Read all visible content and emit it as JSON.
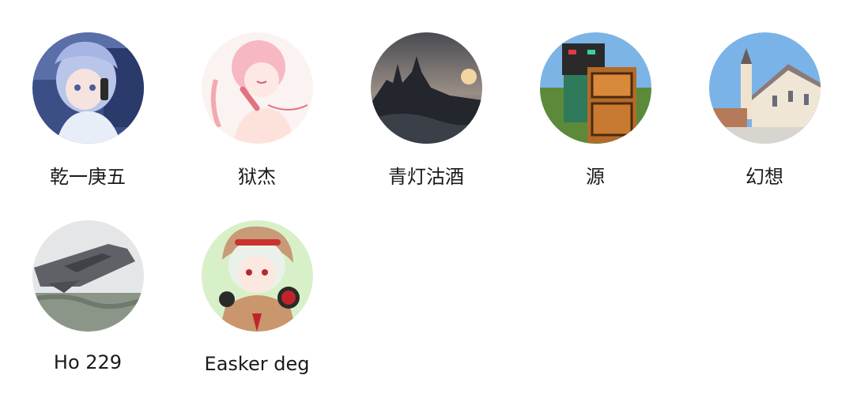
{
  "members": [
    {
      "name": "乾一庚五",
      "avatar_icon": "anime-girl-phone-avatar-icon"
    },
    {
      "name": "狱杰",
      "avatar_icon": "pink-anime-phone-avatar-icon"
    },
    {
      "name": "青灯沽酒",
      "avatar_icon": "castle-dusk-avatar-icon"
    },
    {
      "name": "源",
      "avatar_icon": "minecraft-character-avatar-icon"
    },
    {
      "name": "幻想",
      "avatar_icon": "church-town-avatar-icon"
    },
    {
      "name": "Ho 229",
      "avatar_icon": "flying-wing-aircraft-avatar-icon"
    },
    {
      "name": "Easker deg",
      "avatar_icon": "anime-headphones-avatar-icon"
    }
  ]
}
